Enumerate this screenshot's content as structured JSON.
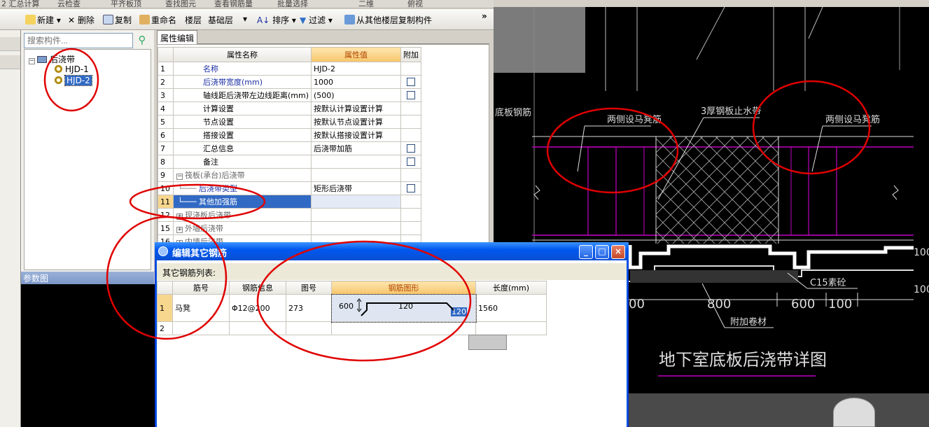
{
  "top_strip": {
    "items": [
      "2 汇总计算",
      "云检查",
      "平齐板顶",
      "查找图元",
      "查看钢筋量",
      "批量选择",
      "二维",
      "俯视"
    ],
    "close_glyph": "× ×"
  },
  "toolbar": {
    "new_label": "新建",
    "delete_label": "删除",
    "copy_label": "复制",
    "rename_label": "重命名",
    "floor_label": "楼层",
    "floor_value": "基础层",
    "sort_label": "排序",
    "filter_label": "过滤",
    "copy_from_floor_label": "从其他楼层复制构件",
    "more_glyph": "»"
  },
  "tree_panel": {
    "search_placeholder": "搜索构件...",
    "root": "后浇带",
    "items": [
      "HJD-1",
      "HJD-2"
    ],
    "selected": "HJD-2",
    "param_pane_label": "参数图"
  },
  "property_editor": {
    "tab_label": "属性编辑",
    "columns": [
      "属性名称",
      "属性值",
      "附加"
    ],
    "rows": [
      {
        "num": "1",
        "name": "名称",
        "value": "HJD-2",
        "check": false
      },
      {
        "num": "2",
        "name": "后浇带宽度(mm)",
        "value": "1000",
        "check": true
      },
      {
        "num": "3",
        "name": "轴线距后浇带左边线距离(mm)",
        "value": "(500)",
        "check": true
      },
      {
        "num": "4",
        "name": "计算设置",
        "value": "按默认计算设置计算",
        "check": false
      },
      {
        "num": "5",
        "name": "节点设置",
        "value": "按默认节点设置计算",
        "check": false
      },
      {
        "num": "6",
        "name": "搭接设置",
        "value": "按默认搭接设置计算",
        "check": false
      },
      {
        "num": "7",
        "name": "汇总信息",
        "value": "后浇带加筋",
        "check": true
      },
      {
        "num": "8",
        "name": "备注",
        "value": "",
        "check": true
      },
      {
        "num": "9",
        "name": "筏板(承台)后浇带",
        "value": "",
        "check": false
      },
      {
        "num": "10",
        "name": "后浇带类型",
        "value": "矩形后浇带",
        "check": true
      },
      {
        "num": "11",
        "name": "其他加强筋",
        "value": "",
        "check": false
      },
      {
        "num": "12",
        "name": "现浇板后浇带",
        "value": "",
        "check": false
      },
      {
        "num": "15",
        "name": "外墙后浇带",
        "value": "",
        "check": false
      },
      {
        "num": "16",
        "name": "内墙后浇带",
        "value": "",
        "check": false
      }
    ],
    "expand_glyph": "+",
    "collapse_glyph": "−"
  },
  "dialog": {
    "title": "编辑其它钢筋",
    "list_label": "其它钢筋列表:",
    "columns": [
      "筋号",
      "钢筋信息",
      "图号",
      "钢筋图形",
      "长度(mm)"
    ],
    "rows": [
      {
        "num": "1",
        "bar": "马凳",
        "info": "Φ12@200",
        "fig": "273",
        "len": "1560",
        "shape": {
          "left": "600",
          "mid": "120",
          "right": "120"
        }
      },
      {
        "num": "2",
        "bar": "",
        "info": "",
        "fig": "",
        "len": "",
        "shape": null
      }
    ],
    "minimize_glyph": "_",
    "maximize_glyph": "□",
    "close_glyph": "×"
  },
  "cad": {
    "labels": {
      "bottom_rebar": "底板钢筋",
      "bench_left": "两侧设马凳筋",
      "steel_stop": "3厚钢板止水带",
      "bench_right": "两侧设马凳筋",
      "c15": "C15素砼",
      "waterproof": "附加卷材",
      "title": "地下室底板后浇带详图"
    },
    "dims": [
      "800",
      "600",
      "100",
      "00"
    ],
    "right_edge_text": [
      "100",
      "100"
    ]
  },
  "colors": {
    "accent_red": "#e00000",
    "selection_blue": "#316ac5",
    "header_orange": "#f7c56a",
    "cad_magenta": "#c000c0"
  }
}
